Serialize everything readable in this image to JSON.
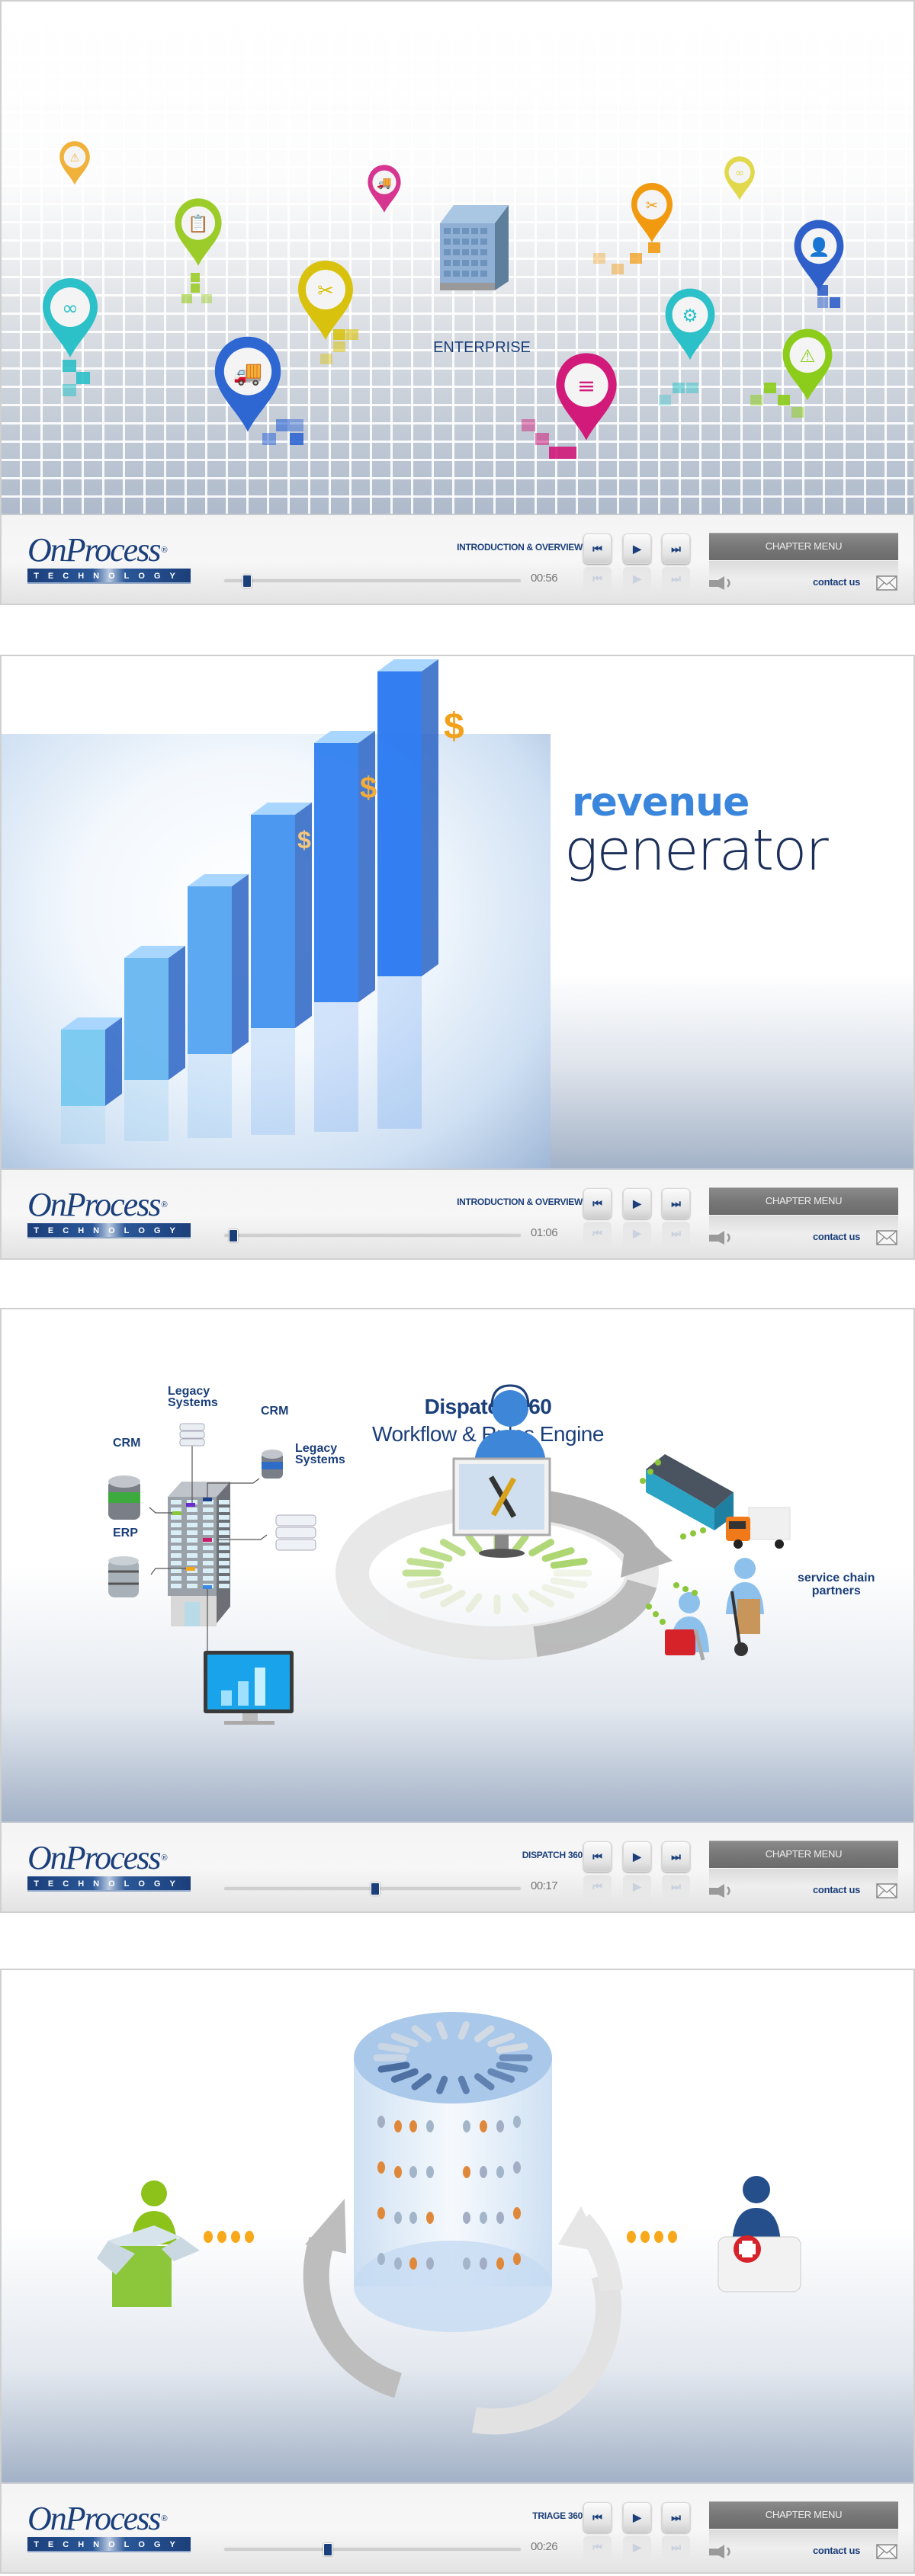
{
  "common": {
    "logo_word": "OnProcess",
    "logo_reg": "®",
    "logo_tag": "TECHNOLOGY",
    "chapter_menu_label": "CHAPTER MENU",
    "contact_label": "contact us",
    "buttons": {
      "prev": "⏮",
      "play": "▶",
      "next": "⏭"
    },
    "icons": {
      "prev": "skip-back-icon",
      "play": "play-icon",
      "next": "skip-forward-icon",
      "volume": "speaker-icon",
      "contact": "envelope-icon"
    },
    "colors": {
      "navy": "#1b3f7a",
      "chapter_menu_bg": "#777777",
      "slider_track": "#cfcfcf"
    }
  },
  "panels": [
    {
      "chapter": "INTRODUCTION & OVERVIEW",
      "time": "00:56",
      "progress": 0.077,
      "scene": {
        "label": "ENTERPRISE",
        "pins": [
          {
            "icon": "warning-icon",
            "color": "#f0b23a",
            "glyph": "⚠"
          },
          {
            "icon": "clipboard-icon",
            "color": "#9ccc2a",
            "glyph": "📋"
          },
          {
            "icon": "truck-icon",
            "color": "#d6368f",
            "glyph": "🚚"
          },
          {
            "icon": "tools-icon",
            "color": "#f19a10",
            "glyph": "✂"
          },
          {
            "icon": "binoculars-icon",
            "color": "#e2d84c",
            "glyph": "∞"
          },
          {
            "icon": "user-icon",
            "color": "#2f5fc8",
            "glyph": "👤"
          },
          {
            "icon": "binoculars-icon",
            "color": "#2cc0c8",
            "glyph": "∞"
          },
          {
            "icon": "tools-icon",
            "color": "#d8c20e",
            "glyph": "✂"
          },
          {
            "icon": "truck-icon",
            "color": "#2e66d2",
            "glyph": "🚚"
          },
          {
            "icon": "database-icon",
            "color": "#d21a7a",
            "glyph": "≡"
          },
          {
            "icon": "gears-icon",
            "color": "#2cc0c8",
            "glyph": "⚙"
          },
          {
            "icon": "warning-icon",
            "color": "#8ccc1a",
            "glyph": "⚠"
          }
        ]
      }
    },
    {
      "chapter": "INTRODUCTION & OVERVIEW",
      "time": "01:06",
      "progress": 0.031,
      "scene": {
        "title_line1": "revenue",
        "title_line2": "generator",
        "dollar": "$",
        "bars_relative": [
          1,
          2,
          3,
          4,
          5,
          6
        ]
      }
    },
    {
      "chapter": "DISPATCH 360",
      "time": "00:17",
      "progress": 0.51,
      "scene": {
        "title": "Dispatch 360",
        "subtitle": "Workflow & Rules Engine",
        "labels": {
          "legacy_top": [
            "Legacy",
            "Systems"
          ],
          "crm_top": "CRM",
          "crm_left": "CRM",
          "legacy_right": [
            "Legacy",
            "Systems"
          ],
          "erp": "ERP",
          "partners": [
            "service chain",
            "partners"
          ]
        }
      }
    },
    {
      "chapter": "TRIAGE 360",
      "time": "00:26",
      "progress": 0.35,
      "scene": {}
    }
  ]
}
